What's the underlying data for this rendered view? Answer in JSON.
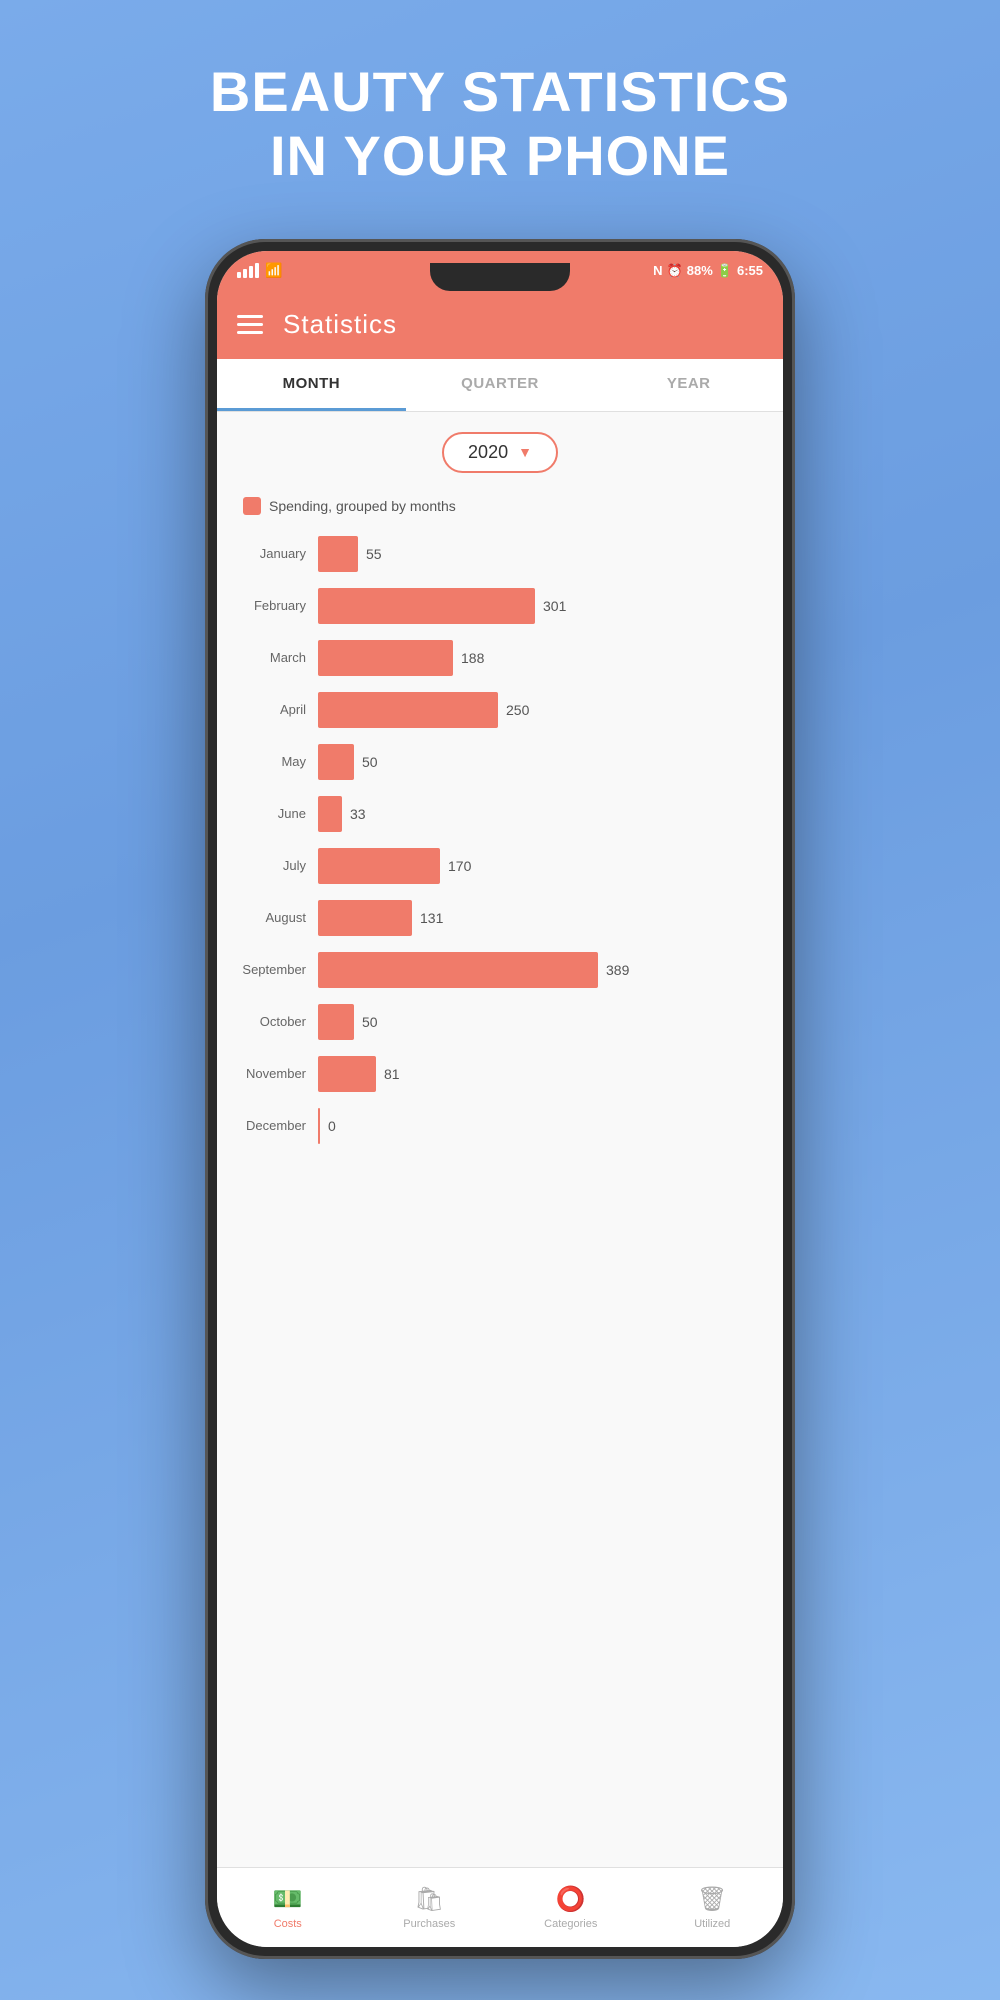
{
  "hero": {
    "line1": "BEAUTY STATISTICS",
    "line2": "IN YOUR PHONE"
  },
  "status_bar": {
    "time": "6:55",
    "battery": "88%"
  },
  "header": {
    "title": "Statistics"
  },
  "tabs": [
    {
      "id": "month",
      "label": "MONTH",
      "active": true
    },
    {
      "id": "quarter",
      "label": "QUARTER",
      "active": false
    },
    {
      "id": "year",
      "label": "YEAR",
      "active": false
    }
  ],
  "year_selector": {
    "value": "2020"
  },
  "chart": {
    "legend": "Spending, grouped by months",
    "max_value": 389,
    "bar_width_percent": 100,
    "rows": [
      {
        "month": "January",
        "value": 55
      },
      {
        "month": "February",
        "value": 301
      },
      {
        "month": "March",
        "value": 188
      },
      {
        "month": "April",
        "value": 250
      },
      {
        "month": "May",
        "value": 50
      },
      {
        "month": "June",
        "value": 33
      },
      {
        "month": "July",
        "value": 170
      },
      {
        "month": "August",
        "value": 131
      },
      {
        "month": "September",
        "value": 389
      },
      {
        "month": "October",
        "value": 50
      },
      {
        "month": "November",
        "value": 81
      },
      {
        "month": "December",
        "value": 0
      }
    ]
  },
  "bottom_nav": [
    {
      "id": "costs",
      "label": "Costs",
      "icon": "💵",
      "active": true
    },
    {
      "id": "purchases",
      "label": "Purchases",
      "icon": "🛍",
      "active": false
    },
    {
      "id": "categories",
      "label": "Categories",
      "icon": "⭕",
      "active": false
    },
    {
      "id": "utilized",
      "label": "Utilized",
      "icon": "🗑",
      "active": false
    }
  ]
}
